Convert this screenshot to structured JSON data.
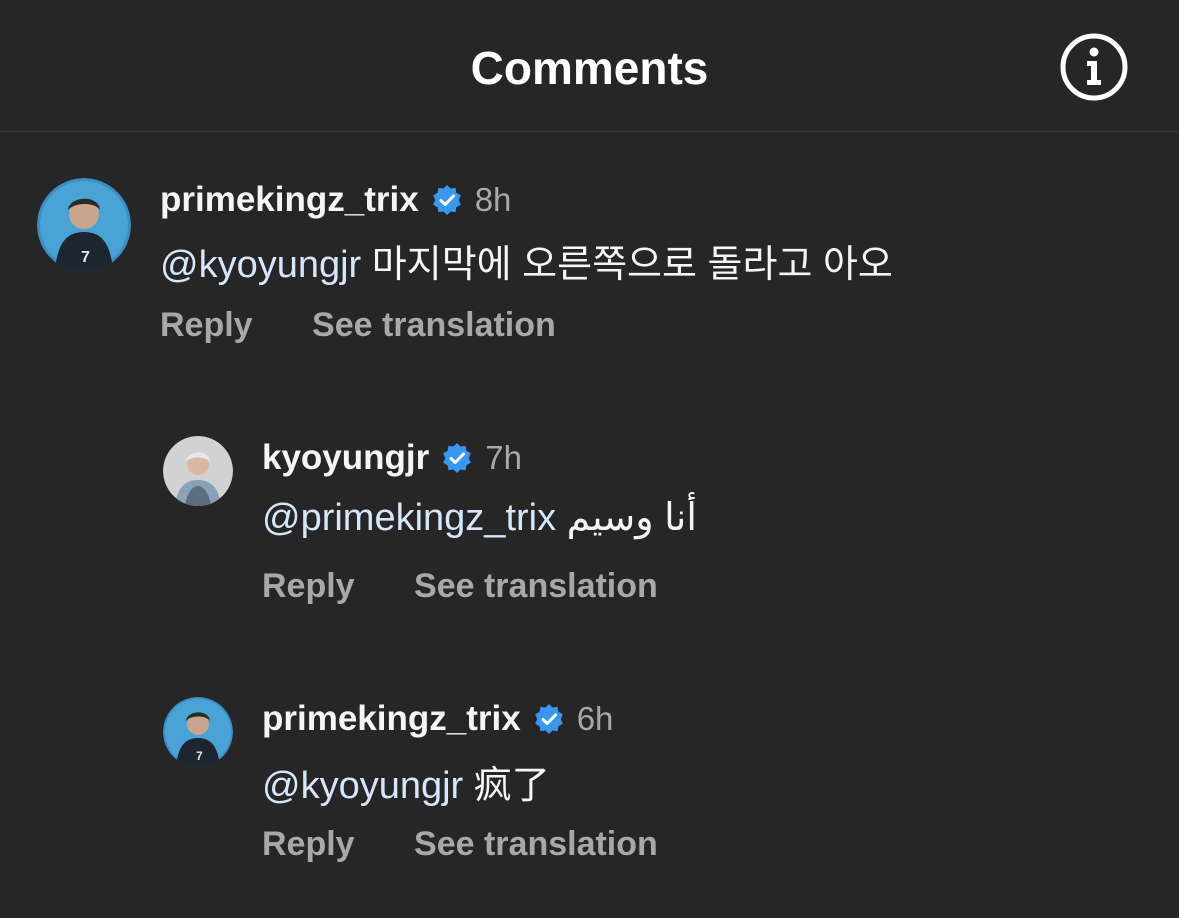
{
  "header": {
    "title": "Comments",
    "info_icon": "info-circle-icon"
  },
  "comments": [
    {
      "username": "primekingz_trix",
      "verified": true,
      "time": "8h",
      "mention": "@kyoyungjr",
      "text": "마지막에 오른쪽으로 돌라고 아오",
      "reply_label": "Reply",
      "translate_label": "See translation"
    },
    {
      "username": "kyoyungjr",
      "verified": true,
      "time": "7h",
      "mention": "@primekingz_trix",
      "text": "أنا وسيم",
      "reply_label": "Reply",
      "translate_label": "See translation"
    },
    {
      "username": "primekingz_trix",
      "verified": true,
      "time": "6h",
      "mention": "@kyoyungjr",
      "text": "疯了",
      "reply_label": "Reply",
      "translate_label": "See translation"
    }
  ],
  "colors": {
    "background": "#262626",
    "text_primary": "#f5f5f5",
    "text_secondary": "#a8a8a8",
    "mention": "#d6e6fb",
    "verified_badge": "#3897f0"
  }
}
